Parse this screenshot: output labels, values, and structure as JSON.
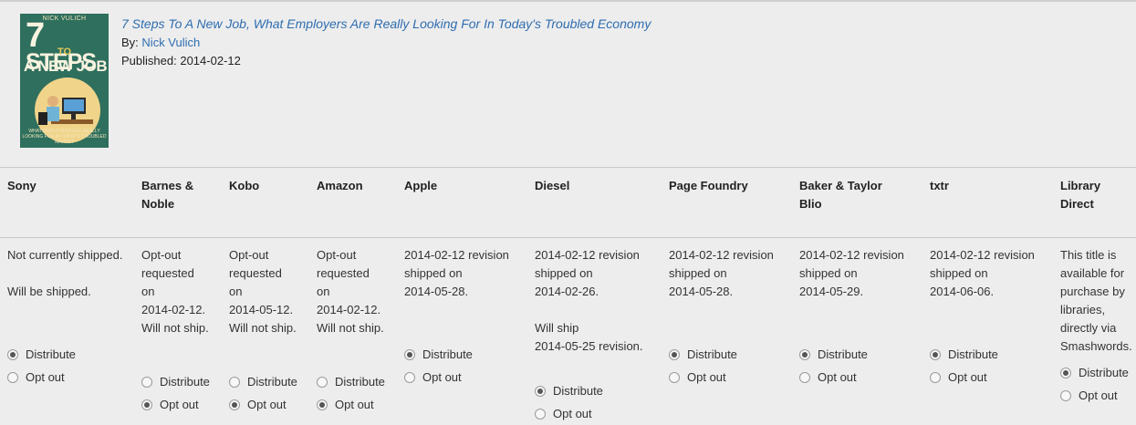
{
  "book": {
    "cover": {
      "author": "NICK VULICH",
      "title_line1": "7 STEPS",
      "title_line2": "TO",
      "title_line3": "A NEW JOB",
      "tagline": "WHAT EMPLOYERS ARE REALLY LOOKING FOR IN TODAY'S TROUBLED MARKET"
    },
    "title": "7 Steps To A New Job, What Employers Are Really Looking For In Today's Troubled Economy",
    "by_label": "By:",
    "author": "Nick Vulich",
    "published_label": "Published:",
    "published_date": "2014-02-12"
  },
  "retailers": [
    {
      "name_lines": [
        "Sony"
      ],
      "status": [
        "Not currently shipped.",
        "",
        "Will be shipped."
      ],
      "distribute_label": "Distribute",
      "optout_label": "Opt out",
      "selected": "distribute"
    },
    {
      "name_lines": [
        "Barnes &",
        "Noble"
      ],
      "status": [
        "Opt-out",
        "requested",
        "on",
        "2014-02-12.",
        "Will not ship."
      ],
      "distribute_label": "Distribute",
      "optout_label": "Opt out",
      "selected": "optout"
    },
    {
      "name_lines": [
        "Kobo"
      ],
      "status": [
        "Opt-out",
        "requested",
        "on",
        "2014-05-12.",
        "Will not ship."
      ],
      "distribute_label": "Distribute",
      "optout_label": "Opt out",
      "selected": "optout"
    },
    {
      "name_lines": [
        "Amazon"
      ],
      "status": [
        "Opt-out",
        "requested",
        "on",
        "2014-02-12.",
        "Will not ship."
      ],
      "distribute_label": "Distribute",
      "optout_label": "Opt out",
      "selected": "optout"
    },
    {
      "name_lines": [
        "Apple"
      ],
      "status": [
        "2014-02-12 revision",
        "shipped on",
        "2014-05-28."
      ],
      "distribute_label": "Distribute",
      "optout_label": "Opt out",
      "selected": "distribute"
    },
    {
      "name_lines": [
        "Diesel"
      ],
      "status": [
        "2014-02-12 revision",
        "shipped on",
        "2014-02-26.",
        "",
        "Will ship",
        "2014-05-25 revision."
      ],
      "distribute_label": "Distribute",
      "optout_label": "Opt out",
      "selected": "distribute"
    },
    {
      "name_lines": [
        "Page Foundry"
      ],
      "status": [
        "2014-02-12 revision",
        "shipped on",
        "2014-05-28."
      ],
      "distribute_label": "Distribute",
      "optout_label": "Opt out",
      "selected": "distribute"
    },
    {
      "name_lines": [
        "Baker & Taylor",
        "Blio"
      ],
      "status": [
        "2014-02-12 revision",
        "shipped on",
        "2014-05-29."
      ],
      "distribute_label": "Distribute",
      "optout_label": "Opt out",
      "selected": "distribute"
    },
    {
      "name_lines": [
        "txtr"
      ],
      "status": [
        "2014-02-12 revision",
        "shipped on",
        "2014-06-06."
      ],
      "distribute_label": "Distribute",
      "optout_label": "Opt out",
      "selected": "distribute"
    },
    {
      "name_lines": [
        "Library",
        "Direct"
      ],
      "status": [
        "This title is",
        "available for",
        "purchase by",
        "libraries,",
        "directly via",
        "Smashwords."
      ],
      "distribute_label": "Distribute",
      "optout_label": "Opt out",
      "selected": "distribute"
    }
  ]
}
